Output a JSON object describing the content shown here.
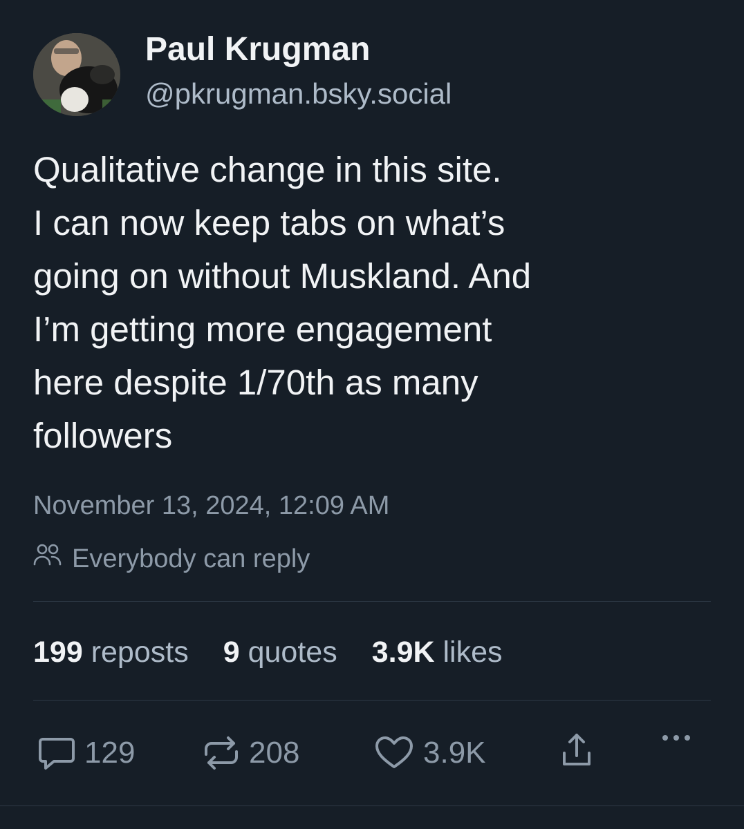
{
  "author": {
    "name": "Paul Krugman",
    "handle": "@pkrugman.bsky.social"
  },
  "post": {
    "lines": [
      "Qualitative change in this site.",
      "I can now keep tabs on what’s",
      "going on without Muskland. And",
      "I’m getting more engagement",
      "here despite 1/70th as many",
      "followers"
    ],
    "timestamp": "November 13, 2024, 12:09 AM",
    "reply_setting": "Everybody can reply"
  },
  "stats": {
    "reposts": {
      "count": "199",
      "label": "reposts"
    },
    "quotes": {
      "count": "9",
      "label": "quotes"
    },
    "likes": {
      "count": "3.9K",
      "label": "likes"
    }
  },
  "actions": {
    "reply_count": "129",
    "repost_count": "208",
    "like_count": "3.9K",
    "icons": [
      "reply-icon",
      "repost-icon",
      "like-icon",
      "share-icon",
      "more-icon"
    ]
  },
  "colors": {
    "background": "#161e27",
    "primary_text": "#f1f3f5",
    "secondary_text": "#aebbc9",
    "muted_text": "#8d9aa8",
    "divider": "#2e3946"
  }
}
